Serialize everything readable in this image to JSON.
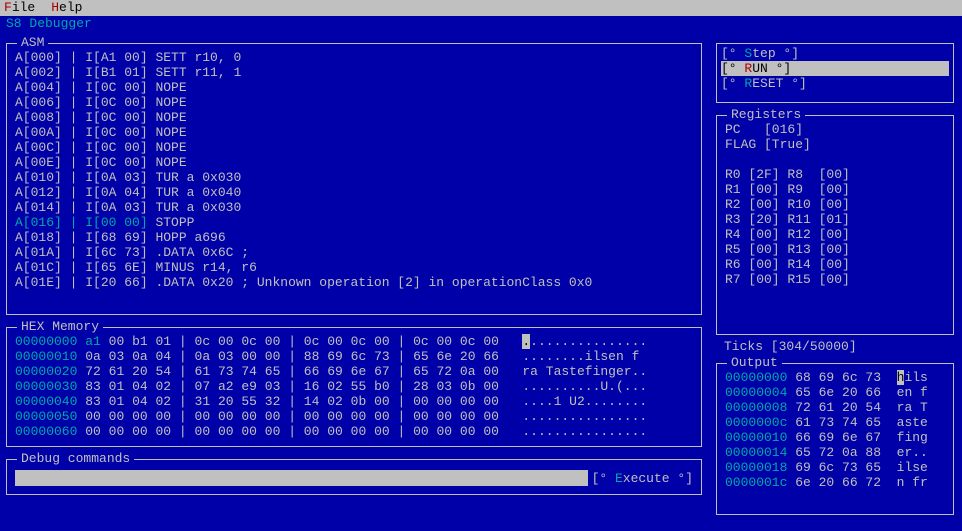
{
  "menubar": {
    "file": {
      "full": "File",
      "hot": "F",
      "rest": "ile"
    },
    "help": {
      "full": "Help",
      "hot": "H",
      "rest": "elp"
    }
  },
  "title": "S8 Debugger",
  "asm": {
    "legend": "ASM",
    "lines": [
      {
        "addr": "A[000]",
        "instr": "I[A1 00]",
        "text": "SETT r10, 0",
        "current": false
      },
      {
        "addr": "A[002]",
        "instr": "I[B1 01]",
        "text": "SETT r11, 1",
        "current": false
      },
      {
        "addr": "A[004]",
        "instr": "I[0C 00]",
        "text": "NOPE",
        "current": false
      },
      {
        "addr": "A[006]",
        "instr": "I[0C 00]",
        "text": "NOPE",
        "current": false
      },
      {
        "addr": "A[008]",
        "instr": "I[0C 00]",
        "text": "NOPE",
        "current": false
      },
      {
        "addr": "A[00A]",
        "instr": "I[0C 00]",
        "text": "NOPE",
        "current": false
      },
      {
        "addr": "A[00C]",
        "instr": "I[0C 00]",
        "text": "NOPE",
        "current": false
      },
      {
        "addr": "A[00E]",
        "instr": "I[0C 00]",
        "text": "NOPE",
        "current": false
      },
      {
        "addr": "A[010]",
        "instr": "I[0A 03]",
        "text": "TUR a 0x030",
        "current": false
      },
      {
        "addr": "A[012]",
        "instr": "I[0A 04]",
        "text": "TUR a 0x040",
        "current": false
      },
      {
        "addr": "A[014]",
        "instr": "I[0A 03]",
        "text": "TUR a 0x030",
        "current": false
      },
      {
        "addr": "A[016]",
        "instr": "I[00 00]",
        "text": "STOPP",
        "current": true
      },
      {
        "addr": "A[018]",
        "instr": "I[68 69]",
        "text": "HOPP a696",
        "current": false
      },
      {
        "addr": "A[01A]",
        "instr": "I[6C 73]",
        "text": ".DATA 0x6C ;",
        "current": false
      },
      {
        "addr": "A[01C]",
        "instr": "I[65 6E]",
        "text": "MINUS r14, r6",
        "current": false
      },
      {
        "addr": "A[01E]",
        "instr": "I[20 66]",
        "text": ".DATA 0x20 ; Unknown operation [2] in operationClass 0x0",
        "current": false
      }
    ]
  },
  "hex": {
    "legend": "HEX Memory",
    "rows": [
      {
        "addr": "00000000",
        "b": [
          "a1",
          "00",
          "b1",
          "01",
          "0c",
          "00",
          "0c",
          "00",
          "0c",
          "00",
          "0c",
          "00",
          "0c",
          "00",
          "0c",
          "00"
        ],
        "ascii": "................",
        "firstHl": true,
        "cursor": 0
      },
      {
        "addr": "00000010",
        "b": [
          "0a",
          "03",
          "0a",
          "04",
          "0a",
          "03",
          "00",
          "00",
          "88",
          "69",
          "6c",
          "73",
          "65",
          "6e",
          "20",
          "66"
        ],
        "ascii": "........ilsen f",
        "firstHl": false
      },
      {
        "addr": "00000020",
        "b": [
          "72",
          "61",
          "20",
          "54",
          "61",
          "73",
          "74",
          "65",
          "66",
          "69",
          "6e",
          "67",
          "65",
          "72",
          "0a",
          "00"
        ],
        "ascii": "ra Tastefinger..",
        "firstHl": false
      },
      {
        "addr": "00000030",
        "b": [
          "83",
          "01",
          "04",
          "02",
          "07",
          "a2",
          "e9",
          "03",
          "16",
          "02",
          "55",
          "b0",
          "28",
          "03",
          "0b",
          "00"
        ],
        "ascii": "..........U.(...",
        "firstHl": false
      },
      {
        "addr": "00000040",
        "b": [
          "83",
          "01",
          "04",
          "02",
          "31",
          "20",
          "55",
          "32",
          "14",
          "02",
          "0b",
          "00",
          "00",
          "00",
          "00",
          "00"
        ],
        "ascii": "....1 U2........",
        "firstHl": false
      },
      {
        "addr": "00000050",
        "b": [
          "00",
          "00",
          "00",
          "00",
          "00",
          "00",
          "00",
          "00",
          "00",
          "00",
          "00",
          "00",
          "00",
          "00",
          "00",
          "00"
        ],
        "ascii": "................",
        "firstHl": false
      },
      {
        "addr": "00000060",
        "b": [
          "00",
          "00",
          "00",
          "00",
          "00",
          "00",
          "00",
          "00",
          "00",
          "00",
          "00",
          "00",
          "00",
          "00",
          "00",
          "00"
        ],
        "ascii": "................",
        "firstHl": false
      }
    ]
  },
  "debug": {
    "legend": "Debug commands",
    "input_value": "",
    "placeholder": "",
    "execute": {
      "pre": "[° ",
      "hot": "E",
      "rest": "xecute °]"
    }
  },
  "buttons": {
    "step": {
      "pre": "[° ",
      "hot": "S",
      "rest": "tep °]"
    },
    "run": {
      "pre": "[° ",
      "hot": "R",
      "rest": "UN °]"
    },
    "reset": {
      "pre": "[° ",
      "hot": "R",
      "rest": "ESET °]"
    }
  },
  "registers": {
    "legend": "Registers",
    "lines": [
      "PC   [016]",
      "FLAG [True]",
      "",
      "R0 [2F] R8  [00]",
      "R1 [00] R9  [00]",
      "R2 [00] R10 [00]",
      "R3 [20] R11 [01]",
      "R4 [00] R12 [00]",
      "R5 [00] R13 [00]",
      "R6 [00] R14 [00]",
      "R7 [00] R15 [00]"
    ]
  },
  "ticks": "Ticks [304/50000]",
  "output": {
    "legend": "Output",
    "rows": [
      {
        "addr": "00000000",
        "hex": "68 69 6c 73",
        "ascii": "hils",
        "cursor": 0
      },
      {
        "addr": "00000004",
        "hex": "65 6e 20 66",
        "ascii": "en f"
      },
      {
        "addr": "00000008",
        "hex": "72 61 20 54",
        "ascii": "ra T"
      },
      {
        "addr": "0000000c",
        "hex": "61 73 74 65",
        "ascii": "aste"
      },
      {
        "addr": "00000010",
        "hex": "66 69 6e 67",
        "ascii": "fing"
      },
      {
        "addr": "00000014",
        "hex": "65 72 0a 88",
        "ascii": "er.."
      },
      {
        "addr": "00000018",
        "hex": "69 6c 73 65",
        "ascii": "ilse"
      },
      {
        "addr": "0000001c",
        "hex": "6e 20 66 72",
        "ascii": "n fr"
      }
    ]
  }
}
